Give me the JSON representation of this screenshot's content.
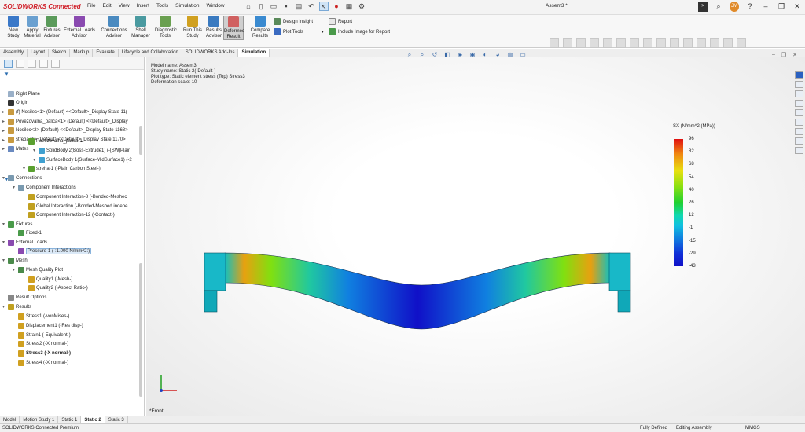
{
  "app": {
    "brand": "SOLIDWORKS Connected",
    "doc_title": "Assem3 *"
  },
  "menu": [
    "File",
    "Edit",
    "View",
    "Insert",
    "Tools",
    "Simulation",
    "Window"
  ],
  "ribbon": {
    "buttons": [
      {
        "label1": "New",
        "label2": "Study",
        "color": "#3a78c8"
      },
      {
        "label1": "Apply",
        "label2": "Material",
        "color": "#6aa0d0"
      },
      {
        "label1": "Fixtures",
        "label2": "Advisor",
        "color": "#5a9a5a"
      },
      {
        "label1": "External Loads",
        "label2": "Advisor",
        "color": "#8a4ab0"
      },
      {
        "label1": "Connections",
        "label2": "Advisor",
        "color": "#4a8ac0"
      },
      {
        "label1": "Shell",
        "label2": "Manager",
        "color": "#4a9aa0"
      },
      {
        "label1": "Diagnostic",
        "label2": "Tools",
        "color": "#6aa050"
      },
      {
        "label1": "Run This",
        "label2": "Study",
        "color": "#d0a020"
      },
      {
        "label1": "Results",
        "label2": "Advisor",
        "color": "#3a7ac0"
      },
      {
        "label1": "Deformed",
        "label2": "Result",
        "color": "#d06060"
      },
      {
        "label1": "Compare",
        "label2": "Results",
        "color": "#3a8ad0"
      }
    ],
    "design_insight": "Design Insight",
    "plot_tools": "Plot Tools",
    "report": "Report",
    "include_image": "Include Image for Report"
  },
  "tabs": [
    "Assembly",
    "Layout",
    "Sketch",
    "Markup",
    "Evaluate",
    "Lifecycle and Collaboration",
    "SOLIDWORKS Add-Ins",
    "Simulation"
  ],
  "feature_tree": [
    "Right Plane",
    "Origin",
    "(f) Nosilec<1> (Default) <<Default>_Display State 11(",
    "Povezovalna_palica<1> (Default) <<Default>_Display",
    "Nosilec<2> (Default) <<Default>_Display State 1168>",
    "streha<1> (Default) <<Default>_Display State 1170>",
    "Mates"
  ],
  "sim_tree": {
    "items": [
      "Povezovalna_palica-1",
      "SolidBody 2(Boss-Extrude1) (-[SW]Plain",
      "SurfaceBody 1(Surface-MidSurface1) (-2",
      "streha-1 (-Plain Carbon Steel-)",
      "Connections",
      "Component Interactions",
      "Component Interaction-8 (-Bonded-Meshec",
      "Global Interaction (-Bonded-Meshed indepe",
      "Component Interaction-12 (-Contact-)",
      "Fixtures",
      "Fixed-1",
      "External Loads",
      "Pressure-1 (-:1.000 N/mm^2:)",
      "Mesh",
      "Mesh Quality Plot",
      "Quality1 (-Mesh-)",
      "Quality2 (-Aspect Ratio-)",
      "Result Options",
      "Results",
      "Stress1 (-vonMises-)",
      "Displacement1 (-Res disp-)",
      "Strain1 (-Equivalent-)",
      "Stress2 (-X normal-)",
      "Stress3 (-X normal-)",
      "Stress4 (-X normal-)"
    ]
  },
  "viewport": {
    "info": [
      "Model name: Assem3",
      "Study name: Static 2(-Default-)",
      "Plot type: Static element stress (Top) Stress3",
      "Deformation scale: 10"
    ],
    "view_label": "*Front",
    "legend": {
      "title": "SX (N/mm^2 (MPa))",
      "labels": [
        "96",
        "82",
        "68",
        "54",
        "40",
        "26",
        "12",
        "-1",
        "-15",
        "-29",
        "-43"
      ]
    }
  },
  "bottom_tabs": [
    "Model",
    "Motion Study 1",
    "Static 1",
    "Static 2",
    "Static 3"
  ],
  "status": {
    "left": "SOLIDWORKS Connected Premium",
    "defined": "Fully Defined",
    "editing": "Editing Assembly",
    "units": "MMGS"
  }
}
